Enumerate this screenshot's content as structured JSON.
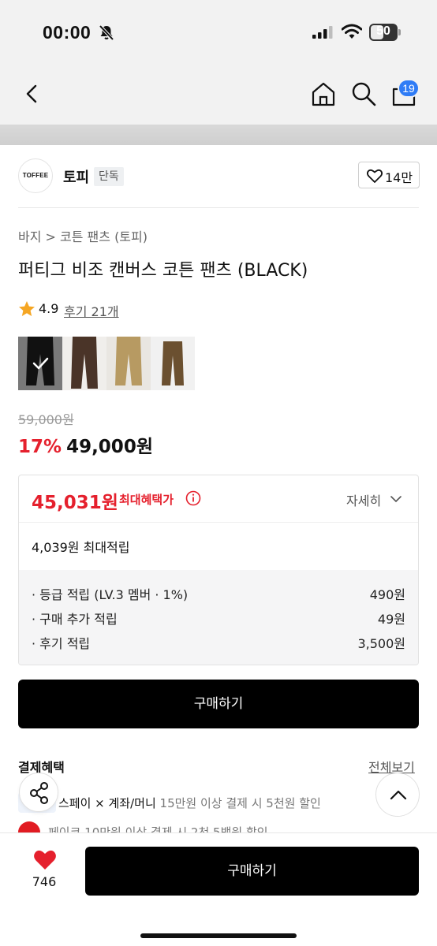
{
  "status_bar": {
    "time": "00:00",
    "battery": "50"
  },
  "nav": {
    "cart_count": "19"
  },
  "brand": {
    "logo_text": "TOFFEE",
    "name": "토피",
    "tag": "단독",
    "likes": "14만"
  },
  "product": {
    "breadcrumb": "바지 > 코튼 팬츠 (토피)",
    "title": "퍼티그 비조 캔버스 코튼 팬츠 (BLACK)",
    "rating": "4.9",
    "reviews": "후기 21개",
    "thumbnails": [
      {
        "color": "#2a2a2a",
        "selected": true
      },
      {
        "color": "#4a3428",
        "selected": false
      },
      {
        "color": "#b79a62",
        "selected": false
      },
      {
        "color": "#6b5030",
        "selected": false
      }
    ],
    "original_price": "59,000원",
    "discount_rate": "17%",
    "sale_price": "49,000원"
  },
  "benefit": {
    "best_price": "45,031원",
    "best_label": "최대혜택가",
    "detail_label": "자세히",
    "max_points": "4,039원 최대적립",
    "items": [
      {
        "label": "· 등급 적립 (LV.3 멤버 · 1%)",
        "amount": "490원"
      },
      {
        "label": "· 구매 추가 적립",
        "amount": "49원"
      },
      {
        "label": "· 후기 적립",
        "amount": "3,500원"
      }
    ]
  },
  "buy_label": "구매하기",
  "payment": {
    "title": "결제혜택",
    "view_all": "전체보기",
    "row1_main": "스페이 × 계좌/머니",
    "row1_sub": "15만원 이상 결제 시 5천원 할인",
    "row2": "페이코 10만원 이상 결제 시 2천 5백원 할인"
  },
  "bottom": {
    "like_count": "746",
    "buy_label": "구매하기"
  },
  "colors": {
    "accent_red": "#e5202d",
    "badge_blue": "#2f7cf6",
    "button_black": "#000000"
  }
}
